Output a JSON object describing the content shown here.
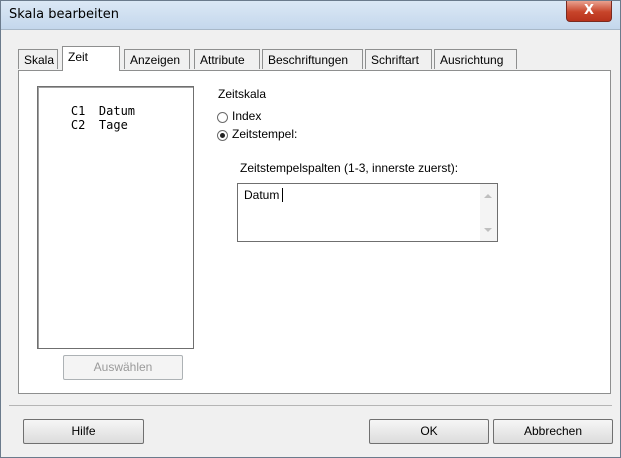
{
  "window": {
    "title": "Skala bearbeiten",
    "close_label": "X"
  },
  "tabs": [
    {
      "label": "Skala"
    },
    {
      "label": "Zeit"
    },
    {
      "label": "Anzeigen"
    },
    {
      "label": "Attribute"
    },
    {
      "label": "Beschriftungen"
    },
    {
      "label": "Schriftart"
    },
    {
      "label": "Ausrichtung"
    }
  ],
  "columns": [
    {
      "id": "C1",
      "name": "Datum"
    },
    {
      "id": "C2",
      "name": "Tage"
    }
  ],
  "select_button": "Auswählen",
  "time_scale": {
    "heading": "Zeitskala",
    "options": [
      {
        "label": "Index",
        "checked": false
      },
      {
        "label": "Zeitstempel:",
        "checked": true
      }
    ],
    "stamp_columns_label": "Zeitstempelspalten (1-3, innerste zuerst):",
    "stamp_columns_value": "Datum"
  },
  "footer": {
    "help": "Hilfe",
    "ok": "OK",
    "cancel": "Abbrechen"
  }
}
